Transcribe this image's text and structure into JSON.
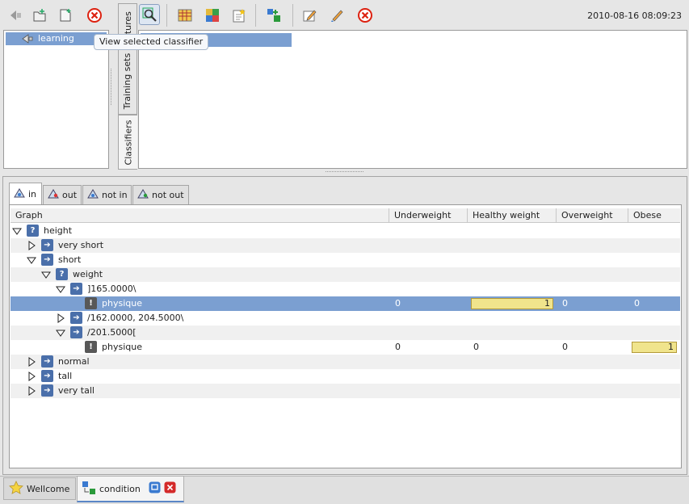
{
  "window": {
    "timestamp": "2010-08-16 08:09:23"
  },
  "left_toolbar": {
    "icons": [
      "back-icon",
      "new-folder-icon",
      "new-file-icon",
      "delete-icon"
    ]
  },
  "left_tree": {
    "items": [
      {
        "label": "learning",
        "selected": true
      }
    ]
  },
  "vertical_tabs": [
    {
      "label": "atures",
      "active": false
    },
    {
      "label": "Training sets",
      "active": false
    },
    {
      "label": "Classifiers",
      "active": true
    }
  ],
  "main_toolbar": {
    "icons": [
      "view-classifier-icon",
      "table-icon",
      "puzzle-icon",
      "star-note-icon",
      "export-icon",
      "edit-icon",
      "brush-icon",
      "close-icon"
    ],
    "tooltip": "View selected classifier"
  },
  "lower_tabs": [
    {
      "label": "in",
      "active": true
    },
    {
      "label": "out",
      "active": false
    },
    {
      "label": "not in",
      "active": false
    },
    {
      "label": "not out",
      "active": false
    }
  ],
  "table": {
    "columns": [
      "Graph",
      "Underweight",
      "Healthy weight",
      "Overweight",
      "Obese"
    ],
    "rows": [
      {
        "label": "height",
        "depth": 0,
        "expanded": true,
        "icon": "question-node-icon"
      },
      {
        "label": "very short",
        "depth": 1,
        "expanded": false,
        "icon": "arrow-node-icon"
      },
      {
        "label": "short",
        "depth": 1,
        "expanded": true,
        "icon": "arrow-node-icon"
      },
      {
        "label": "weight",
        "depth": 2,
        "expanded": true,
        "icon": "question-node-icon"
      },
      {
        "label": "]165.0000\\",
        "depth": 3,
        "expanded": true,
        "icon": "arrow-node-icon"
      },
      {
        "label": "physique",
        "depth": 4,
        "leaf": true,
        "icon": "exclamation-node-icon",
        "selected": true,
        "values": [
          "0",
          "1",
          "0",
          "0"
        ],
        "highlight": 1
      },
      {
        "label": "/162.0000, 204.5000\\",
        "depth": 3,
        "expanded": false,
        "icon": "arrow-node-icon"
      },
      {
        "label": "/201.5000[",
        "depth": 3,
        "expanded": true,
        "icon": "arrow-node-icon"
      },
      {
        "label": "physique",
        "depth": 4,
        "leaf": true,
        "icon": "exclamation-node-icon",
        "values": [
          "0",
          "0",
          "0",
          "1"
        ],
        "highlight": 3
      },
      {
        "label": "normal",
        "depth": 1,
        "expanded": false,
        "icon": "arrow-node-icon"
      },
      {
        "label": "tall",
        "depth": 1,
        "expanded": false,
        "icon": "arrow-node-icon"
      },
      {
        "label": "very tall",
        "depth": 1,
        "expanded": false,
        "icon": "arrow-node-icon"
      }
    ]
  },
  "bottom_tabs": [
    {
      "label": "Wellcome",
      "icon": "star-icon",
      "active": false
    },
    {
      "label": "condition",
      "icon": "classifier-icon",
      "active": true
    }
  ],
  "colors": {
    "selection": "#7b9fd1",
    "highlight_bar": "#f0e48c",
    "node_blue": "#4a6faa"
  }
}
